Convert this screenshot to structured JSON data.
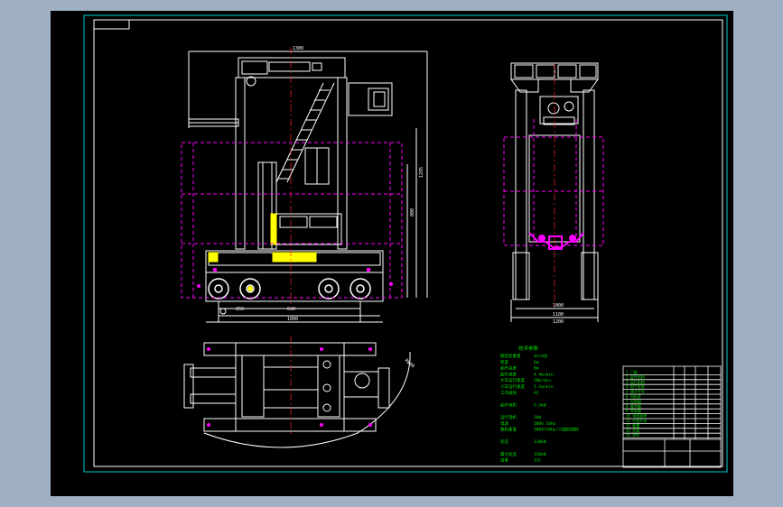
{
  "drawing": {
    "dimensions": {
      "top_width": "1300",
      "right_height_1": "1295",
      "right_height_2": "800",
      "bottom_1": "250",
      "bottom_2": "600",
      "bottom_3": "1000",
      "side_1": "1000",
      "side_2": "1100",
      "side_3": "1200",
      "radius": "R800"
    },
    "tech_params": {
      "heading": "技术参数",
      "rows": [
        {
          "label": "额定起重量",
          "value": "4t×4台"
        },
        {
          "label": "跨度",
          "value": "6m"
        },
        {
          "label": "起升高度",
          "value": "8m"
        },
        {
          "label": "起升速度",
          "value": "4.4m/min"
        },
        {
          "label": "大车运行速度",
          "value": "20m/min"
        },
        {
          "label": "小车运行速度",
          "value": "5.1m/min"
        },
        {
          "label": "工作级别",
          "value": "A5"
        },
        {
          "label": "",
          "value": ""
        },
        {
          "label": "起升电机",
          "value": "5.5kW"
        },
        {
          "label": "",
          "value": ""
        },
        {
          "label": "运行电机",
          "value": "3kW"
        },
        {
          "label": "电源",
          "value": "380V 50Hz"
        },
        {
          "label": "整机重量",
          "value": "380V/50Hz/三相四线制"
        },
        {
          "label": "",
          "value": ""
        },
        {
          "label": "轮压",
          "value": "110kN"
        },
        {
          "label": "",
          "value": ""
        },
        {
          "label": "最大轮压",
          "value": "150kN"
        },
        {
          "label": "自重",
          "value": "12t"
        }
      ]
    },
    "bom_rows": [
      "1 门架",
      "2 起升机构",
      "3 运行机构",
      "4 电气系统",
      "5 梯子平台",
      "6 司机室",
      "7 车轮组",
      "8 缓冲器",
      "9 夹轨器",
      "10 电缆卷筒",
      "11 行程开关",
      "12 配重",
      "13 吊具",
      "14 护栏"
    ]
  },
  "colors": {
    "drawing": "#ffffff",
    "frame": "#00d0d0",
    "hidden": "#ff00ff",
    "dimension": "#00e000",
    "highlight": "#ffff00",
    "centerline": "#ff2020"
  }
}
